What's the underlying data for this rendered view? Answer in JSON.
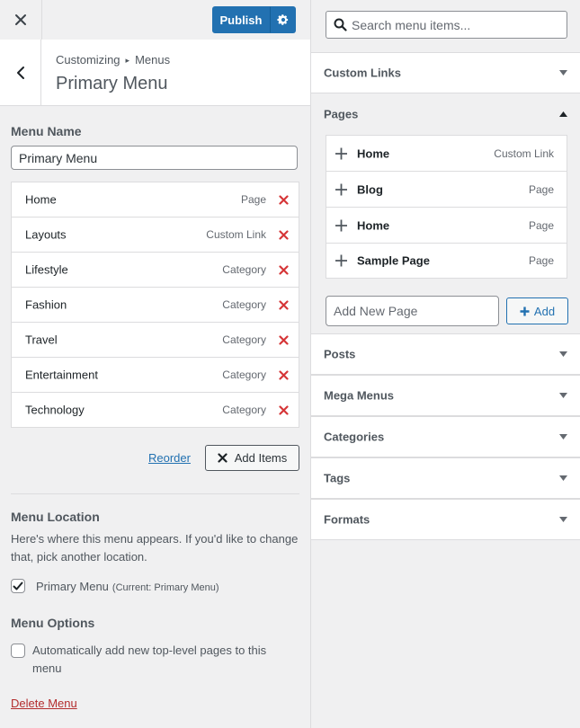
{
  "topbar": {
    "close_icon": "close-icon",
    "publish_label": "Publish",
    "settings_icon": "gear-icon"
  },
  "header": {
    "breadcrumb_parent": "Customizing",
    "breadcrumb_child": "Menus",
    "title": "Primary Menu"
  },
  "menu": {
    "name_label": "Menu Name",
    "name_value": "Primary Menu",
    "items": [
      {
        "title": "Home",
        "type": "Page"
      },
      {
        "title": "Layouts",
        "type": "Custom Link"
      },
      {
        "title": "Lifestyle",
        "type": "Category"
      },
      {
        "title": "Fashion",
        "type": "Category"
      },
      {
        "title": "Travel",
        "type": "Category"
      },
      {
        "title": "Entertainment",
        "type": "Category"
      },
      {
        "title": "Technology",
        "type": "Category"
      }
    ],
    "reorder_label": "Reorder",
    "add_items_label": "Add Items"
  },
  "location": {
    "heading": "Menu Location",
    "description": "Here's where this menu appears. If you'd like to change that, pick another location.",
    "option_label": "Primary Menu",
    "option_current": "(Current: Primary Menu)",
    "checked": true
  },
  "options": {
    "heading": "Menu Options",
    "auto_add_label": "Automatically add new top-level pages to this menu",
    "checked": false
  },
  "delete_label": "Delete Menu",
  "search": {
    "placeholder": "Search menu items..."
  },
  "panels": {
    "custom_links": "Custom Links",
    "pages": "Pages",
    "posts": "Posts",
    "mega_menus": "Mega Menus",
    "categories": "Categories",
    "tags": "Tags",
    "formats": "Formats"
  },
  "pages": {
    "items": [
      {
        "title": "Home",
        "type": "Custom Link"
      },
      {
        "title": "Blog",
        "type": "Page"
      },
      {
        "title": "Home",
        "type": "Page"
      },
      {
        "title": "Sample Page",
        "type": "Page"
      }
    ],
    "new_page_placeholder": "Add New Page",
    "add_label": "Add"
  },
  "colors": {
    "accent": "#2271b1",
    "delete": "#d63638",
    "danger_link": "#b32d2e",
    "background": "#f0f0f1"
  }
}
